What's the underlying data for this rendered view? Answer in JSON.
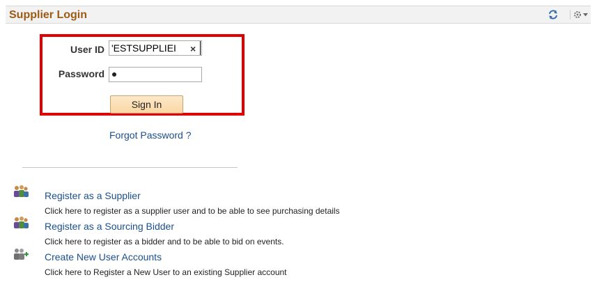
{
  "header": {
    "title": "Supplier Login",
    "icons": [
      "refresh-icon",
      "gear-icon"
    ]
  },
  "login": {
    "userid_label": "User ID",
    "userid_value": "'ESTSUPPLIEI",
    "clear_label": "×",
    "password_label": "Password",
    "password_masked": "•",
    "signin_label": "Sign In"
  },
  "forgot_password": "Forgot Password ?",
  "registrations": [
    {
      "icon": "users-icon",
      "title": "Register as a Supplier",
      "description": "Click here to register as a supplier user and to be able to see purchasing details"
    },
    {
      "icon": "users-icon",
      "title": "Register as a Sourcing Bidder",
      "description": "Click here to register as a bidder and to be able to bid on events."
    },
    {
      "icon": "add-users-icon",
      "title": "Create New User Accounts",
      "description": "Click here to Register a New User to an existing Supplier account"
    }
  ],
  "colors": {
    "title": "#9c5b15",
    "link": "#1a4f8c",
    "highlight": "#e00000"
  }
}
